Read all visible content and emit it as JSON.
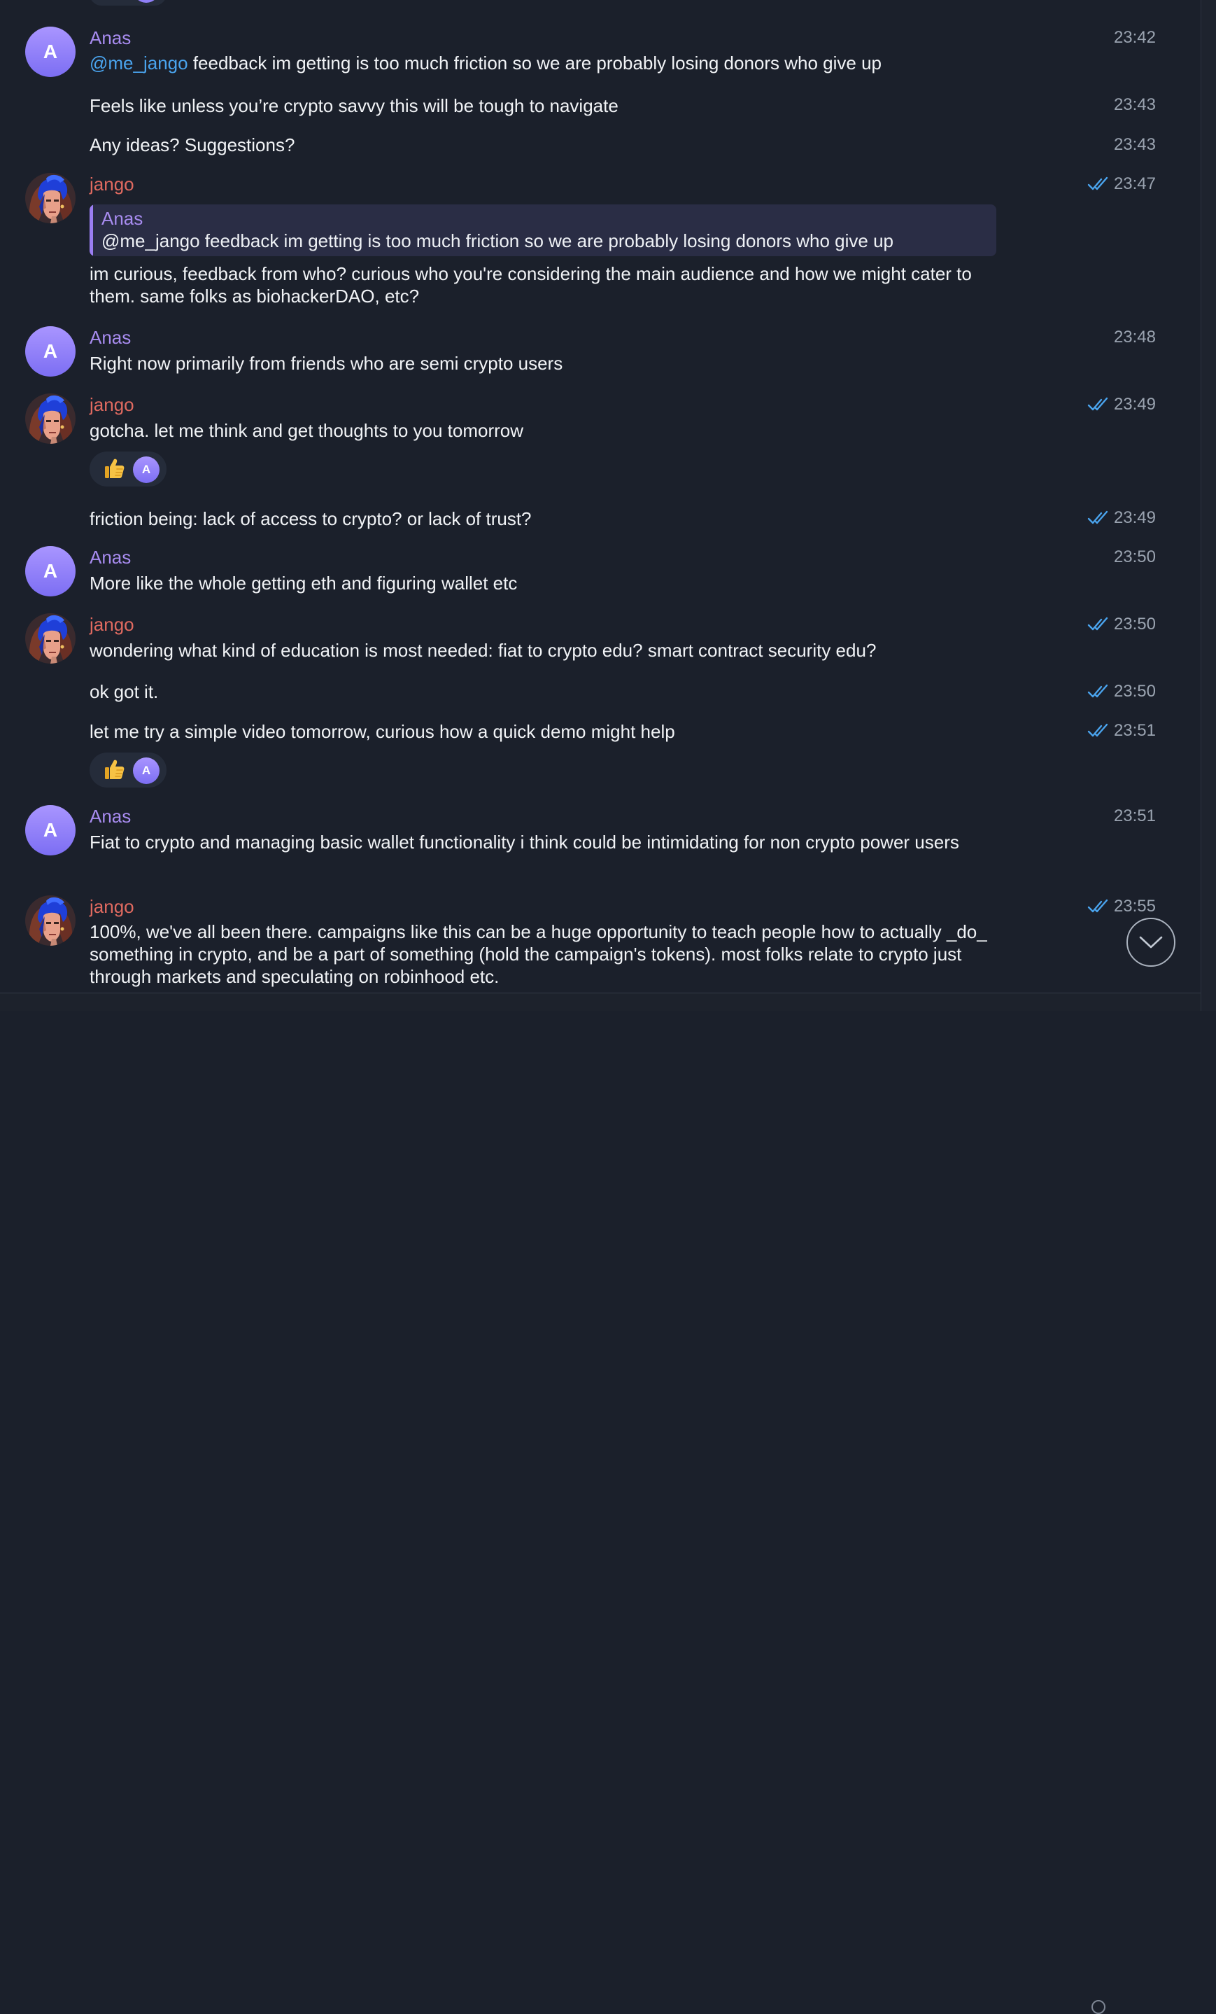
{
  "colors": {
    "background": "#1b202b",
    "sender_anas": "#a88cf0",
    "sender_jango": "#e06a60",
    "mention": "#4aa4ee",
    "read_ticks": "#4aa4ee",
    "timestamp": "#9aa3b0",
    "reply_background": "#2a2d45",
    "reaction_background": "#252c3a"
  },
  "icons": {
    "read_receipt": "double-check-icon",
    "reaction": "thumbs-up-emoji",
    "scroll_down": "chevron-down-icon"
  },
  "messages": [
    {
      "sender": "Anas",
      "avatar_letter": "A",
      "mention": "@me_jango",
      "text": " feedback im getting is too much friction so we are probably losing donors who give up",
      "time": "23:42"
    },
    {
      "text": "Feels like unless you’re crypto savvy this will be tough to navigate",
      "time": "23:43"
    },
    {
      "text": "Any ideas? Suggestions?",
      "time": "23:43"
    },
    {
      "sender": "jango",
      "time": "23:47",
      "reply": {
        "sender": "Anas",
        "text": "@me_jango feedback im getting is too much friction so we are probably losing donors who give up"
      },
      "text": "im curious, feedback from who? curious who you're considering the main audience and how we might cater to them. same folks as biohackerDAO, etc?"
    },
    {
      "sender": "Anas",
      "avatar_letter": "A",
      "text": "Right now primarily from friends who are semi crypto users",
      "time": "23:48"
    },
    {
      "sender": "jango",
      "text": "gotcha. let me think and get thoughts to you tomorrow",
      "time": "23:49",
      "reaction_avatar": "A"
    },
    {
      "text": "friction being: lack of access to crypto? or lack of trust?",
      "time": "23:49"
    },
    {
      "sender": "Anas",
      "avatar_letter": "A",
      "text": "More like the whole getting eth and figuring wallet etc",
      "time": "23:50"
    },
    {
      "sender": "jango",
      "text": "wondering what kind of education is most needed: fiat to crypto edu? smart contract security edu?",
      "time": "23:50"
    },
    {
      "text": "ok got it.",
      "time": "23:50"
    },
    {
      "text": "let me try a simple video tomorrow, curious how a quick demo might help",
      "time": "23:51",
      "reaction_avatar": "A"
    },
    {
      "sender": "Anas",
      "avatar_letter": "A",
      "text": "Fiat to crypto and managing basic wallet functionality i think could be intimidating for non crypto power users",
      "time": "23:51"
    },
    {
      "sender": "jango",
      "text": "100%, we've all been there. campaigns like this can be a huge opportunity to teach people how to actually _do_ something in crypto, and be a part of something (hold the campaign's tokens). most folks relate to crypto just through markets and speculating on robinhood etc.",
      "time": "23:55"
    }
  ]
}
